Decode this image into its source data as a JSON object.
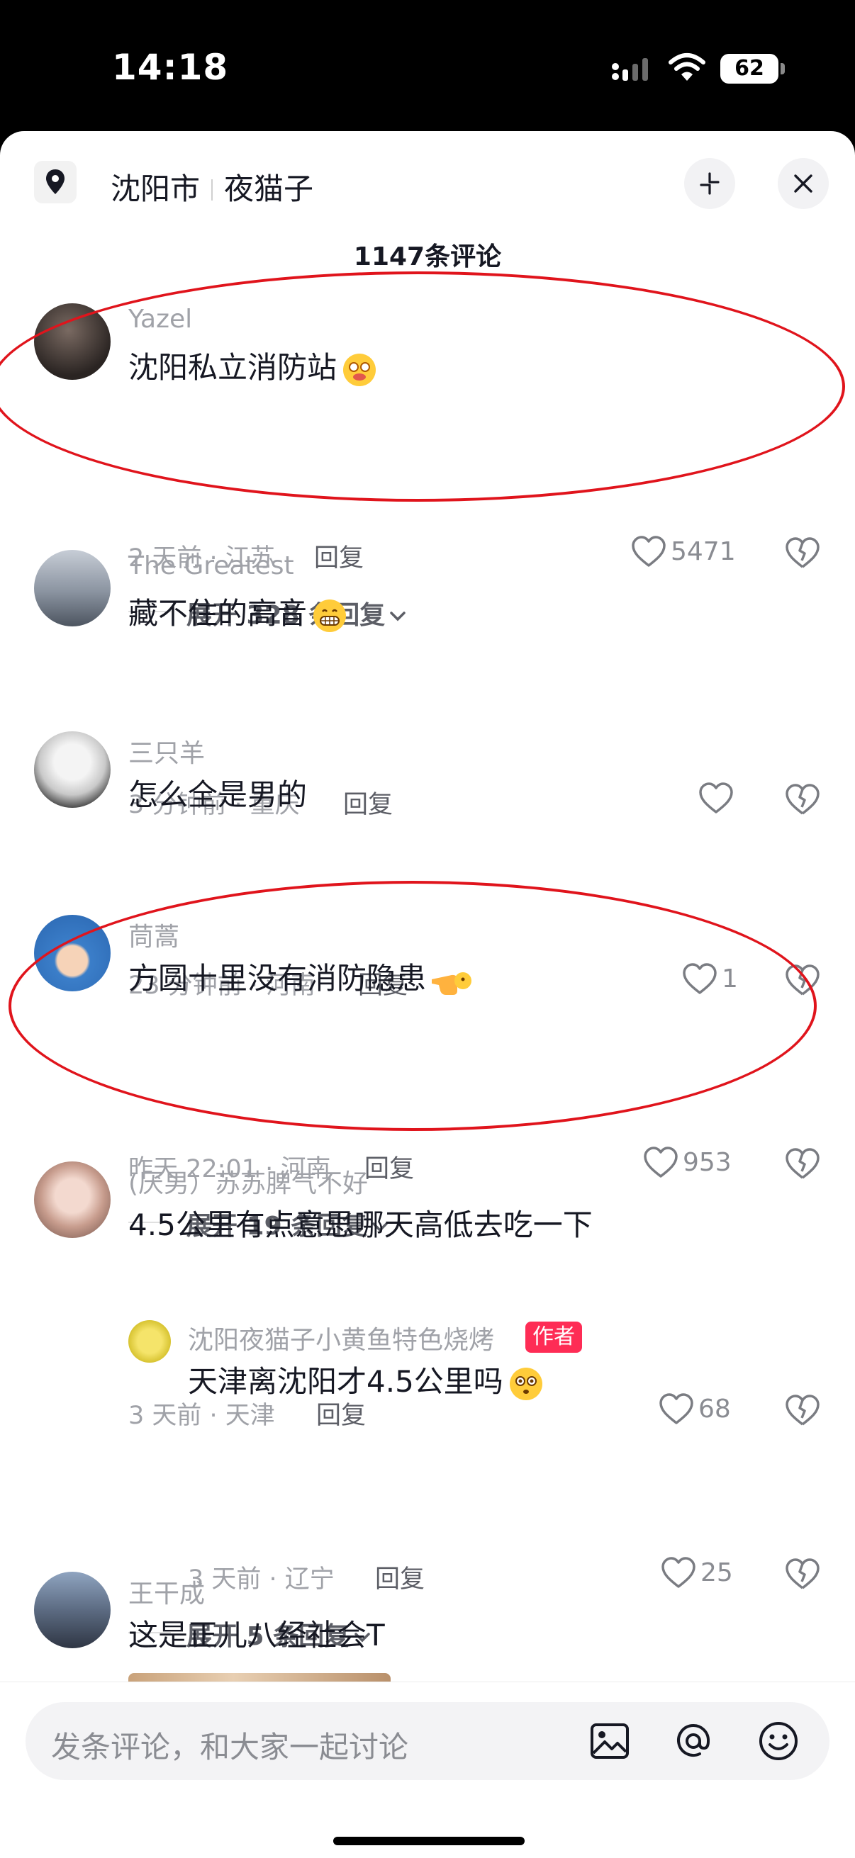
{
  "status": {
    "time": "14:18",
    "battery": "62"
  },
  "header": {
    "location": "沈阳市",
    "shop": "夜猫子"
  },
  "comment_count": "1147条评论",
  "comments": [
    {
      "name": "Yazel",
      "text": "沈阳私立消防站",
      "meta": "2 天前 · 江苏",
      "reply": "回复",
      "likes": "5471",
      "expand": "展开 328 条回复"
    },
    {
      "name": "The Greatest",
      "text": "藏不住的高音",
      "meta": "3 分钟前 · 重庆",
      "reply": "回复",
      "likes": ""
    },
    {
      "name": "三只羊",
      "text": "怎么全是男的",
      "meta": "23 分钟前 · 河南",
      "reply": "回复",
      "likes": "1"
    },
    {
      "name": "茼蒿",
      "text": "方圆十里没有消防隐患",
      "meta": "昨天 22:01 · 河南",
      "reply": "回复",
      "likes": "953",
      "expand": "展开 19 条回复"
    },
    {
      "name": "(厌男）苏苏脾气不好",
      "text": "4.5公里有点意思哪天高低去吃一下",
      "meta": "3 天前 · 天津",
      "reply": "回复",
      "likes": "68",
      "sub_reply": {
        "name": "沈阳夜猫子小黄鱼特色烧烤",
        "badge": "作者",
        "text": "天津离沈阳才4.5公里吗",
        "meta": "3 天前 · 辽宁",
        "reply": "回复",
        "likes": "25"
      },
      "expand": "展开 5 条回复"
    },
    {
      "name": "王干成",
      "text": "这是正儿八经社会T"
    }
  ],
  "input": {
    "placeholder": "发条评论，和大家一起讨论"
  },
  "colors": {
    "accent": "#fe2c55",
    "annotation": "#e0141c"
  }
}
